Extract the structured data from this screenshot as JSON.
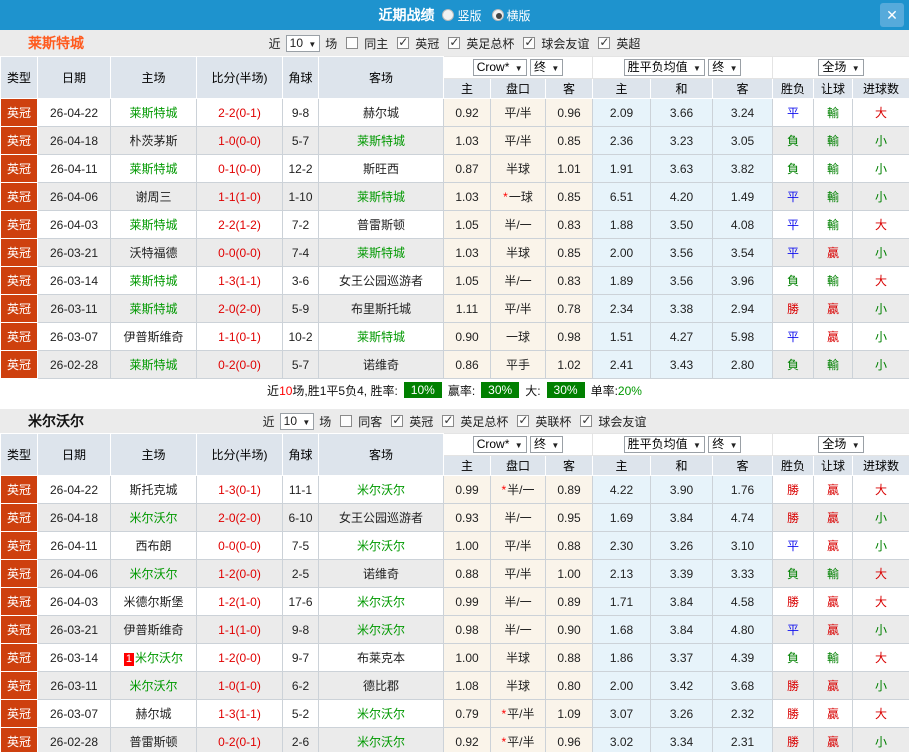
{
  "header": {
    "title": "近期战绩",
    "vertical_label": "竖版",
    "horizontal_label": "横版",
    "close_glyph": "✕",
    "accent_blue": "#1e93ce"
  },
  "table_header": {
    "type": "类型",
    "date": "日期",
    "home": "主场",
    "score": "比分(半场)",
    "corner": "角球",
    "away": "客场",
    "company": "Crow*",
    "final": "终",
    "avg": "胜平负均值",
    "full": "全场",
    "ah_home": "主",
    "handicap": "盘口",
    "ah_away": "客",
    "eu_home": "主",
    "eu_draw": "和",
    "eu_away": "客",
    "wdl": "胜负",
    "handicap_result": "让球",
    "goals": "进球数",
    "dropdown_arrow": "▼"
  },
  "colors": {
    "league_badge": "#ce400e",
    "team_green": "#009900",
    "score_red": "#e00000",
    "win_red": "#d90000",
    "draw_blue": "#1010ee",
    "lose_green": "#008000",
    "summary_badge_green": "#008000"
  },
  "sections": [
    {
      "team": "莱斯特城",
      "filter": {
        "near": "近",
        "count": "10",
        "games": "场",
        "same": "同主",
        "leagues": [
          "英冠",
          "英足总杯",
          "球会友谊",
          "英超"
        ]
      },
      "rows": [
        {
          "league": "英冠",
          "date": "26-04-22",
          "home": "莱斯特城",
          "home_self": true,
          "badge": "",
          "score": "2-2",
          "half": "(0-1)",
          "corners": "9-8",
          "away": "赫尔城",
          "away_self": false,
          "ah_home": "0.92",
          "handicap": "平/半",
          "handicap_star": false,
          "ah_away": "0.96",
          "eu_home": "2.09",
          "eu_draw": "3.66",
          "eu_away": "3.24",
          "wdl": "平",
          "wdl_color": "blue",
          "ah_result": "輸",
          "ah_result_color": "green",
          "ou_result": "大",
          "ou_result_color": "red"
        },
        {
          "league": "英冠",
          "date": "26-04-18",
          "home": "朴茨茅斯",
          "home_self": false,
          "badge": "",
          "score": "1-0",
          "half": "(0-0)",
          "corners": "5-7",
          "away": "莱斯特城",
          "away_self": true,
          "ah_home": "1.03",
          "handicap": "平/半",
          "handicap_star": false,
          "ah_away": "0.85",
          "eu_home": "2.36",
          "eu_draw": "3.23",
          "eu_away": "3.05",
          "wdl": "負",
          "wdl_color": "green",
          "ah_result": "輸",
          "ah_result_color": "green",
          "ou_result": "小",
          "ou_result_color": "green"
        },
        {
          "league": "英冠",
          "date": "26-04-11",
          "home": "莱斯特城",
          "home_self": true,
          "badge": "",
          "score": "0-1",
          "half": "(0-0)",
          "corners": "12-2",
          "away": "斯旺西",
          "away_self": false,
          "ah_home": "0.87",
          "handicap": "半球",
          "handicap_star": false,
          "ah_away": "1.01",
          "eu_home": "1.91",
          "eu_draw": "3.63",
          "eu_away": "3.82",
          "wdl": "負",
          "wdl_color": "green",
          "ah_result": "輸",
          "ah_result_color": "green",
          "ou_result": "小",
          "ou_result_color": "green"
        },
        {
          "league": "英冠",
          "date": "26-04-06",
          "home": "谢周三",
          "home_self": false,
          "badge": "",
          "score": "1-1",
          "half": "(1-0)",
          "corners": "1-10",
          "away": "莱斯特城",
          "away_self": true,
          "ah_home": "1.03",
          "handicap": "一球",
          "handicap_star": true,
          "ah_away": "0.85",
          "eu_home": "6.51",
          "eu_draw": "4.20",
          "eu_away": "1.49",
          "wdl": "平",
          "wdl_color": "blue",
          "ah_result": "輸",
          "ah_result_color": "green",
          "ou_result": "小",
          "ou_result_color": "green"
        },
        {
          "league": "英冠",
          "date": "26-04-03",
          "home": "莱斯特城",
          "home_self": true,
          "badge": "",
          "score": "2-2",
          "half": "(1-2)",
          "corners": "7-2",
          "away": "普雷斯顿",
          "away_self": false,
          "ah_home": "1.05",
          "handicap": "半/一",
          "handicap_star": false,
          "ah_away": "0.83",
          "eu_home": "1.88",
          "eu_draw": "3.50",
          "eu_away": "4.08",
          "wdl": "平",
          "wdl_color": "blue",
          "ah_result": "輸",
          "ah_result_color": "green",
          "ou_result": "大",
          "ou_result_color": "red"
        },
        {
          "league": "英冠",
          "date": "26-03-21",
          "home": "沃特福德",
          "home_self": false,
          "badge": "",
          "score": "0-0",
          "half": "(0-0)",
          "corners": "7-4",
          "away": "莱斯特城",
          "away_self": true,
          "ah_home": "1.03",
          "handicap": "半球",
          "handicap_star": false,
          "ah_away": "0.85",
          "eu_home": "2.00",
          "eu_draw": "3.56",
          "eu_away": "3.54",
          "wdl": "平",
          "wdl_color": "blue",
          "ah_result": "贏",
          "ah_result_color": "red",
          "ou_result": "小",
          "ou_result_color": "green"
        },
        {
          "league": "英冠",
          "date": "26-03-14",
          "home": "莱斯特城",
          "home_self": true,
          "badge": "",
          "score": "1-3",
          "half": "(1-1)",
          "corners": "3-6",
          "away": "女王公园巡游者",
          "away_self": false,
          "ah_home": "1.05",
          "handicap": "半/一",
          "handicap_star": false,
          "ah_away": "0.83",
          "eu_home": "1.89",
          "eu_draw": "3.56",
          "eu_away": "3.96",
          "wdl": "負",
          "wdl_color": "green",
          "ah_result": "輸",
          "ah_result_color": "green",
          "ou_result": "大",
          "ou_result_color": "red"
        },
        {
          "league": "英冠",
          "date": "26-03-11",
          "home": "莱斯特城",
          "home_self": true,
          "badge": "",
          "score": "2-0",
          "half": "(2-0)",
          "corners": "5-9",
          "away": "布里斯托城",
          "away_self": false,
          "ah_home": "1.11",
          "handicap": "平/半",
          "handicap_star": false,
          "ah_away": "0.78",
          "eu_home": "2.34",
          "eu_draw": "3.38",
          "eu_away": "2.94",
          "wdl": "勝",
          "wdl_color": "red",
          "ah_result": "贏",
          "ah_result_color": "red",
          "ou_result": "小",
          "ou_result_color": "green"
        },
        {
          "league": "英冠",
          "date": "26-03-07",
          "home": "伊普斯维奇",
          "home_self": false,
          "badge": "",
          "score": "1-1",
          "half": "(0-1)",
          "corners": "10-2",
          "away": "莱斯特城",
          "away_self": true,
          "ah_home": "0.90",
          "handicap": "一球",
          "handicap_star": false,
          "ah_away": "0.98",
          "eu_home": "1.51",
          "eu_draw": "4.27",
          "eu_away": "5.98",
          "wdl": "平",
          "wdl_color": "blue",
          "ah_result": "贏",
          "ah_result_color": "red",
          "ou_result": "小",
          "ou_result_color": "green"
        },
        {
          "league": "英冠",
          "date": "26-02-28",
          "home": "莱斯特城",
          "home_self": true,
          "badge": "",
          "score": "0-2",
          "half": "(0-0)",
          "corners": "5-7",
          "away": "诺维奇",
          "away_self": false,
          "ah_home": "0.86",
          "handicap": "平手",
          "handicap_star": false,
          "ah_away": "1.02",
          "eu_home": "2.41",
          "eu_draw": "3.43",
          "eu_away": "2.80",
          "wdl": "負",
          "wdl_color": "green",
          "ah_result": "輸",
          "ah_result_color": "green",
          "ou_result": "小",
          "ou_result_color": "green"
        }
      ],
      "summary": {
        "near": "近",
        "count": "10",
        "rest": "场,胜1平5负4, 胜率:",
        "win_rate": "10%",
        "win_label": "赢率:",
        "win_value": "30%",
        "big_label": "大:",
        "big_value": "30%",
        "single_label": "单率:",
        "single_value": "20%"
      }
    },
    {
      "team": "米尔沃尔",
      "filter": {
        "near": "近",
        "count": "10",
        "games": "场",
        "same": "同客",
        "leagues": [
          "英冠",
          "英足总杯",
          "英联杯",
          "球会友谊"
        ]
      },
      "rows": [
        {
          "league": "英冠",
          "date": "26-04-22",
          "home": "斯托克城",
          "home_self": false,
          "badge": "",
          "score": "1-3",
          "half": "(0-1)",
          "corners": "11-1",
          "away": "米尔沃尔",
          "away_self": true,
          "ah_home": "0.99",
          "handicap": "半/一",
          "handicap_star": true,
          "ah_away": "0.89",
          "eu_home": "4.22",
          "eu_draw": "3.90",
          "eu_away": "1.76",
          "wdl": "勝",
          "wdl_color": "red",
          "ah_result": "贏",
          "ah_result_color": "red",
          "ou_result": "大",
          "ou_result_color": "red"
        },
        {
          "league": "英冠",
          "date": "26-04-18",
          "home": "米尔沃尔",
          "home_self": true,
          "badge": "",
          "score": "2-0",
          "half": "(2-0)",
          "corners": "6-10",
          "away": "女王公园巡游者",
          "away_self": false,
          "ah_home": "0.93",
          "handicap": "半/一",
          "handicap_star": false,
          "ah_away": "0.95",
          "eu_home": "1.69",
          "eu_draw": "3.84",
          "eu_away": "4.74",
          "wdl": "勝",
          "wdl_color": "red",
          "ah_result": "贏",
          "ah_result_color": "red",
          "ou_result": "小",
          "ou_result_color": "green"
        },
        {
          "league": "英冠",
          "date": "26-04-11",
          "home": "西布朗",
          "home_self": false,
          "badge": "",
          "score": "0-0",
          "half": "(0-0)",
          "corners": "7-5",
          "away": "米尔沃尔",
          "away_self": true,
          "ah_home": "1.00",
          "handicap": "平/半",
          "handicap_star": false,
          "ah_away": "0.88",
          "eu_home": "2.30",
          "eu_draw": "3.26",
          "eu_away": "3.10",
          "wdl": "平",
          "wdl_color": "blue",
          "ah_result": "贏",
          "ah_result_color": "red",
          "ou_result": "小",
          "ou_result_color": "green"
        },
        {
          "league": "英冠",
          "date": "26-04-06",
          "home": "米尔沃尔",
          "home_self": true,
          "badge": "",
          "score": "1-2",
          "half": "(0-0)",
          "corners": "2-5",
          "away": "诺维奇",
          "away_self": false,
          "ah_home": "0.88",
          "handicap": "平/半",
          "handicap_star": false,
          "ah_away": "1.00",
          "eu_home": "2.13",
          "eu_draw": "3.39",
          "eu_away": "3.33",
          "wdl": "負",
          "wdl_color": "green",
          "ah_result": "輸",
          "ah_result_color": "green",
          "ou_result": "大",
          "ou_result_color": "red"
        },
        {
          "league": "英冠",
          "date": "26-04-03",
          "home": "米德尔斯堡",
          "home_self": false,
          "badge": "",
          "score": "1-2",
          "half": "(1-0)",
          "corners": "17-6",
          "away": "米尔沃尔",
          "away_self": true,
          "ah_home": "0.99",
          "handicap": "半/一",
          "handicap_star": false,
          "ah_away": "0.89",
          "eu_home": "1.71",
          "eu_draw": "3.84",
          "eu_away": "4.58",
          "wdl": "勝",
          "wdl_color": "red",
          "ah_result": "贏",
          "ah_result_color": "red",
          "ou_result": "大",
          "ou_result_color": "red"
        },
        {
          "league": "英冠",
          "date": "26-03-21",
          "home": "伊普斯维奇",
          "home_self": false,
          "badge": "",
          "score": "1-1",
          "half": "(1-0)",
          "corners": "9-8",
          "away": "米尔沃尔",
          "away_self": true,
          "ah_home": "0.98",
          "handicap": "半/一",
          "handicap_star": false,
          "ah_away": "0.90",
          "eu_home": "1.68",
          "eu_draw": "3.84",
          "eu_away": "4.80",
          "wdl": "平",
          "wdl_color": "blue",
          "ah_result": "贏",
          "ah_result_color": "red",
          "ou_result": "小",
          "ou_result_color": "green"
        },
        {
          "league": "英冠",
          "date": "26-03-14",
          "home": "米尔沃尔",
          "home_self": true,
          "badge": "1",
          "score": "1-2",
          "half": "(0-0)",
          "corners": "9-7",
          "away": "布莱克本",
          "away_self": false,
          "ah_home": "1.00",
          "handicap": "半球",
          "handicap_star": false,
          "ah_away": "0.88",
          "eu_home": "1.86",
          "eu_draw": "3.37",
          "eu_away": "4.39",
          "wdl": "負",
          "wdl_color": "green",
          "ah_result": "輸",
          "ah_result_color": "green",
          "ou_result": "大",
          "ou_result_color": "red"
        },
        {
          "league": "英冠",
          "date": "26-03-11",
          "home": "米尔沃尔",
          "home_self": true,
          "badge": "",
          "score": "1-0",
          "half": "(1-0)",
          "corners": "6-2",
          "away": "德比郡",
          "away_self": false,
          "ah_home": "1.08",
          "handicap": "半球",
          "handicap_star": false,
          "ah_away": "0.80",
          "eu_home": "2.00",
          "eu_draw": "3.42",
          "eu_away": "3.68",
          "wdl": "勝",
          "wdl_color": "red",
          "ah_result": "贏",
          "ah_result_color": "red",
          "ou_result": "小",
          "ou_result_color": "green"
        },
        {
          "league": "英冠",
          "date": "26-03-07",
          "home": "赫尔城",
          "home_self": false,
          "badge": "",
          "score": "1-3",
          "half": "(1-1)",
          "corners": "5-2",
          "away": "米尔沃尔",
          "away_self": true,
          "ah_home": "0.79",
          "handicap": "平/半",
          "handicap_star": true,
          "ah_away": "1.09",
          "eu_home": "3.07",
          "eu_draw": "3.26",
          "eu_away": "2.32",
          "wdl": "勝",
          "wdl_color": "red",
          "ah_result": "贏",
          "ah_result_color": "red",
          "ou_result": "大",
          "ou_result_color": "red"
        },
        {
          "league": "英冠",
          "date": "26-02-28",
          "home": "普雷斯顿",
          "home_self": false,
          "badge": "",
          "score": "0-2",
          "half": "(0-1)",
          "corners": "2-6",
          "away": "米尔沃尔",
          "away_self": true,
          "ah_home": "0.92",
          "handicap": "平/半",
          "handicap_star": true,
          "ah_away": "0.96",
          "eu_home": "3.02",
          "eu_draw": "3.34",
          "eu_away": "2.31",
          "wdl": "勝",
          "wdl_color": "red",
          "ah_result": "贏",
          "ah_result_color": "red",
          "ou_result": "小",
          "ou_result_color": "green"
        }
      ]
    }
  ]
}
